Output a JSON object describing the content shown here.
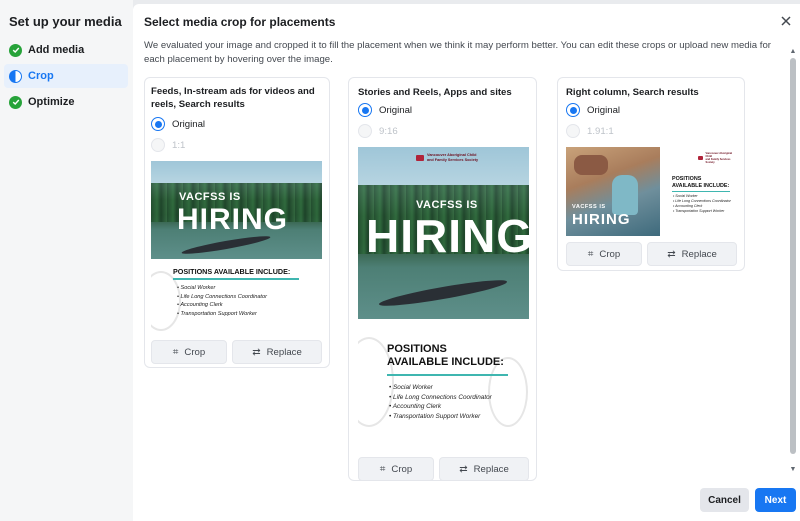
{
  "sidebar": {
    "title": "Set up your media",
    "steps": [
      {
        "label": "Add media",
        "state": "done"
      },
      {
        "label": "Crop",
        "state": "active"
      },
      {
        "label": "Optimize",
        "state": "done"
      }
    ]
  },
  "dialog": {
    "title": "Select media crop for placements",
    "description": "We evaluated your image and cropped it to fill the placement when we think it may perform better. You can edit these crops or upload new media for each placement by hovering over the image."
  },
  "ad": {
    "org_name_line1": "Vancouver Aboriginal Child",
    "org_name_line2": "and Family Services Society",
    "headline_small": "VACFSS IS",
    "headline_big": "HIRING",
    "positions_title": "POSITIONS AVAILABLE INCLUDE:",
    "positions_title_line1": "POSITIONS",
    "positions_title_line2": "AVAILABLE INCLUDE:",
    "positions": [
      "Social Worker",
      "Life Long Connections Coordinator",
      "Accounting Clerk",
      "Transportation Support Worker"
    ]
  },
  "cards": [
    {
      "title": "Feeds, In-stream ads for videos and reels, Search results",
      "option_selected": "Original",
      "option_alt": "1:1",
      "crop_label": "Crop",
      "replace_label": "Replace"
    },
    {
      "title": "Stories and Reels, Apps and sites",
      "option_selected": "Original",
      "option_alt": "9:16",
      "crop_label": "Crop",
      "replace_label": "Replace"
    },
    {
      "title": "Right column, Search results",
      "option_selected": "Original",
      "option_alt": "1.91:1",
      "crop_label": "Crop",
      "replace_label": "Replace"
    }
  ],
  "footer": {
    "cancel_label": "Cancel",
    "next_label": "Next"
  },
  "colors": {
    "accent": "#1877f2",
    "success": "#27a33a",
    "teal": "#3fb6b0"
  }
}
